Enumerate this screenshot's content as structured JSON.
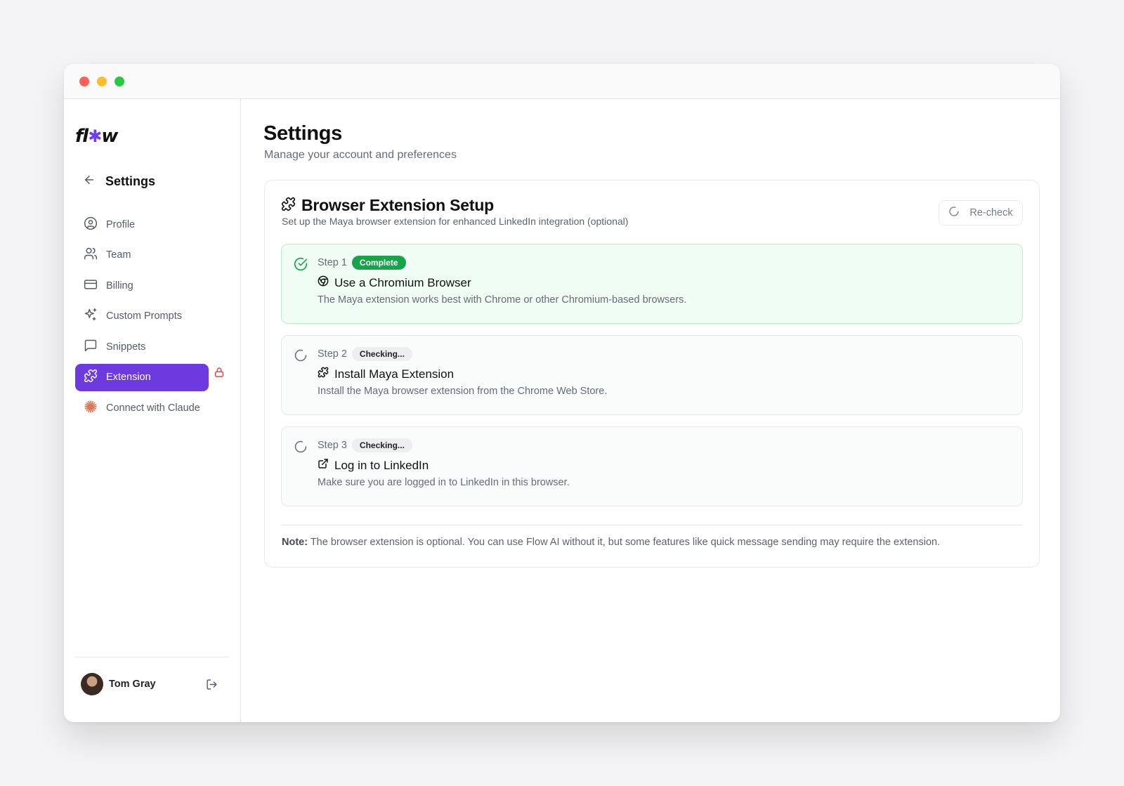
{
  "window": {
    "controls": [
      "close",
      "minimize",
      "maximize"
    ]
  },
  "sidebar": {
    "logo": {
      "left": "fl",
      "star": "✱",
      "right": "w"
    },
    "back_title": "Settings",
    "items": [
      {
        "label": "Profile",
        "icon": "user-circle-icon",
        "active": false
      },
      {
        "label": "Team",
        "icon": "users-icon",
        "active": false
      },
      {
        "label": "Billing",
        "icon": "credit-card-icon",
        "active": false
      },
      {
        "label": "Custom Prompts",
        "icon": "sparkles-icon",
        "active": false
      },
      {
        "label": "Snippets",
        "icon": "message-square-icon",
        "active": false
      },
      {
        "label": "Extension",
        "icon": "puzzle-icon",
        "active": true,
        "locked": true
      },
      {
        "label": "Connect with Claude",
        "icon": "claude-icon",
        "active": false
      }
    ],
    "user": {
      "name": "Tom Gray"
    }
  },
  "main": {
    "title": "Settings",
    "subtitle": "Manage your account and preferences",
    "card": {
      "title": "Browser Extension Setup",
      "description": "Set up the Maya browser extension for enhanced LinkedIn integration (optional)",
      "recheck_label": "Re-check",
      "steps": [
        {
          "step": "Step 1",
          "badge": "Complete",
          "status": "complete",
          "icon": "chrome-icon",
          "title": "Use a Chromium Browser",
          "description": "The Maya extension works best with Chrome or other Chromium-based browsers."
        },
        {
          "step": "Step 2",
          "badge": "Checking...",
          "status": "checking",
          "icon": "puzzle-icon",
          "title": "Install Maya Extension",
          "description": "Install the Maya browser extension from the Chrome Web Store."
        },
        {
          "step": "Step 3",
          "badge": "Checking...",
          "status": "checking",
          "icon": "external-link-icon",
          "title": "Log in to LinkedIn",
          "description": "Make sure you are logged in to LinkedIn in this browser."
        }
      ],
      "note_label": "Note:",
      "note_text": " The browser extension is optional. You can use Flow AI without it, but some features like quick message sending may require the extension."
    }
  },
  "colors": {
    "accent": "#6d3ae0",
    "success": "#17a34a",
    "lock": "#ef4444"
  }
}
